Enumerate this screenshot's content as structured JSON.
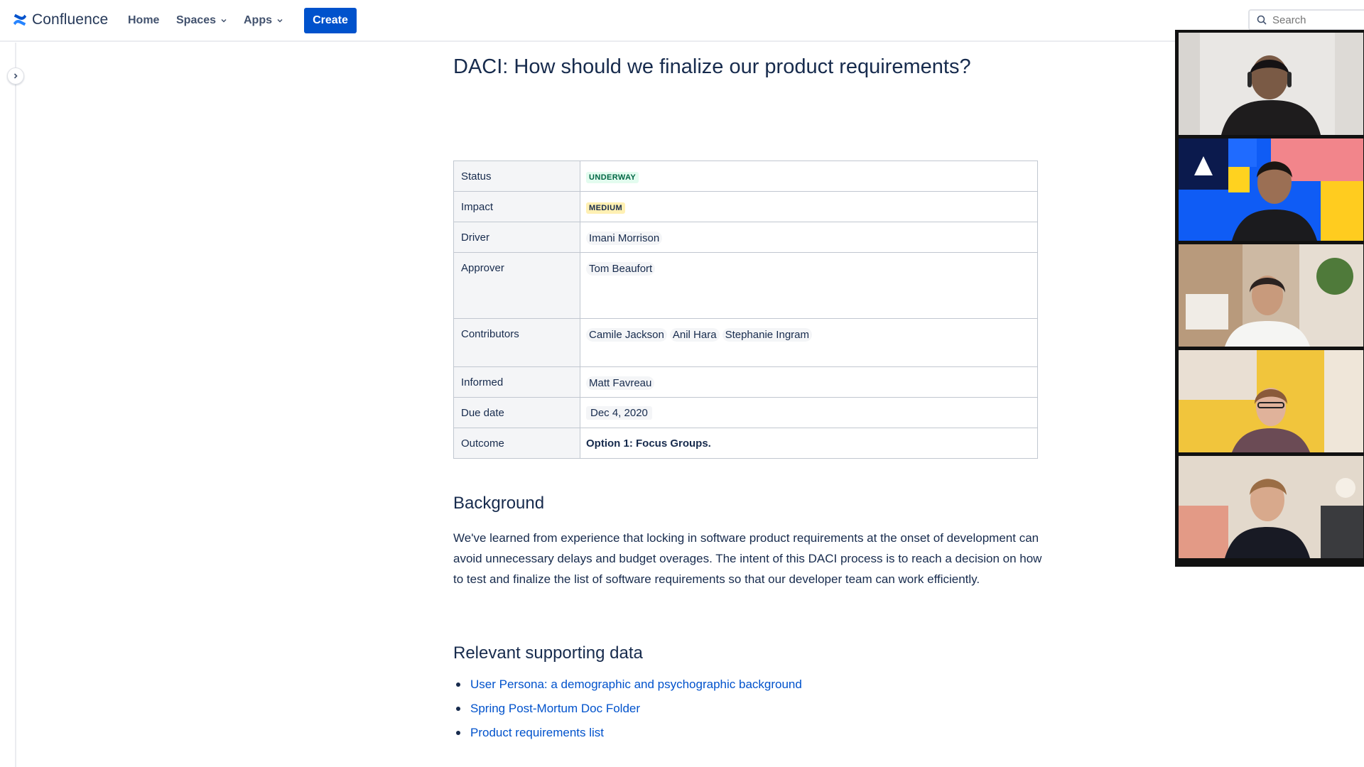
{
  "nav": {
    "brand": "Confluence",
    "home": "Home",
    "spaces": "Spaces",
    "apps": "Apps",
    "create": "Create",
    "search_placeholder": "Search"
  },
  "page": {
    "title": "DACI: How should we finalize our product requirements?"
  },
  "daci_table": {
    "status": {
      "label": "Status",
      "value": "UNDERWAY"
    },
    "impact": {
      "label": "Impact",
      "value": "MEDIUM"
    },
    "driver": {
      "label": "Driver",
      "value": "Imani Morrison"
    },
    "approver": {
      "label": "Approver",
      "value": "Tom Beaufort"
    },
    "contributors": {
      "label": "Contributors",
      "values": [
        "Camile Jackson",
        "Anil Hara",
        "Stephanie Ingram"
      ]
    },
    "informed": {
      "label": "Informed",
      "value": "Matt Favreau"
    },
    "due_date": {
      "label": "Due date",
      "value": "Dec 4, 2020"
    },
    "outcome": {
      "label": "Outcome",
      "value": "Option 1: Focus Groups."
    }
  },
  "background": {
    "heading": "Background",
    "text": "We've learned from experience that locking in software product requirements at the onset of development can avoid unnecessary delays and budget overages. The intent of this DACI process is to reach a decision on how to test and finalize the list of software requirements so that our developer team can work efficiently."
  },
  "supporting": {
    "heading": "Relevant supporting data",
    "links": [
      "User Persona: a demographic and psychographic background",
      "Spring Post-Mortum Doc Folder",
      "Product requirements list"
    ]
  },
  "colors": {
    "brand_blue": "#0052cc",
    "status_green": "#006644",
    "impact_yellow": "#fff0b3"
  },
  "video_participants": 5
}
